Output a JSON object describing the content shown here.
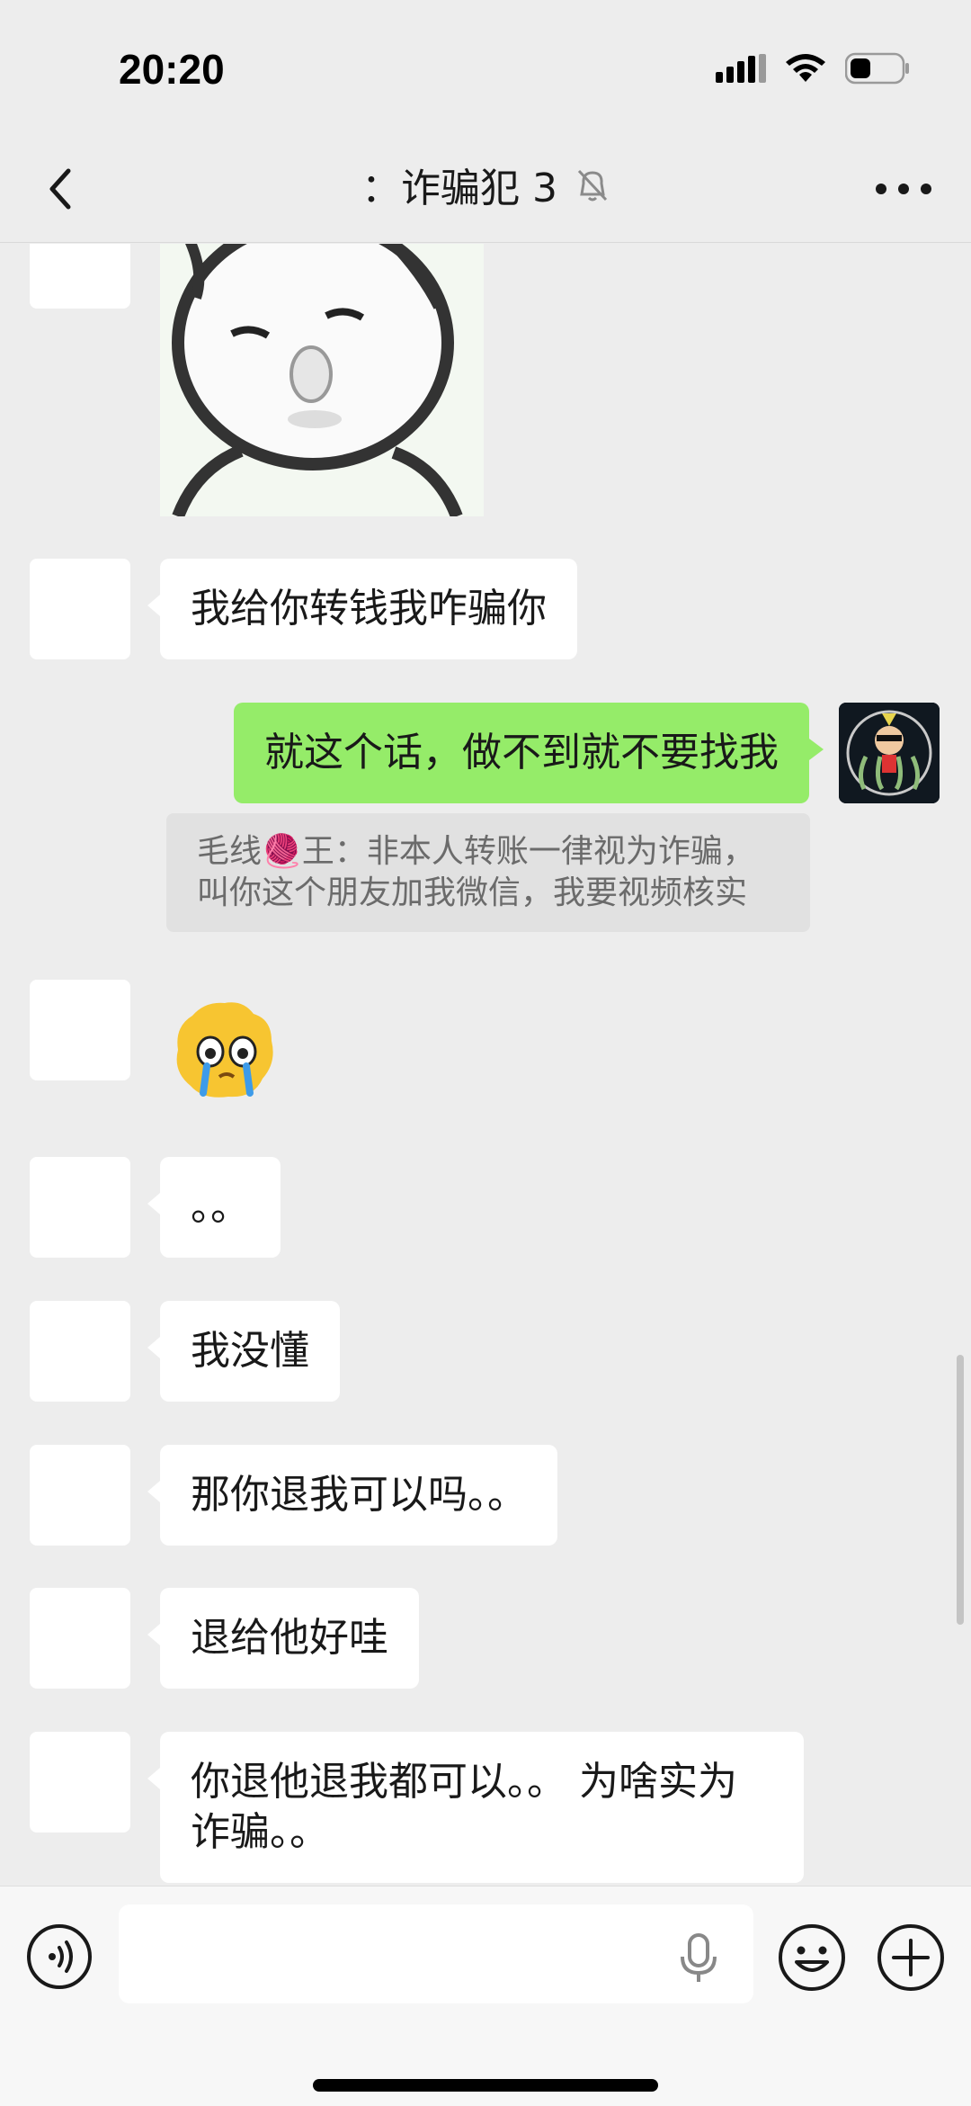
{
  "status_bar": {
    "time": "20:20",
    "icons": [
      "signal-icon",
      "wifi-icon",
      "battery-icon"
    ]
  },
  "nav": {
    "title": "：诈骗犯 3",
    "back_icon": "chevron-left-icon",
    "mute_icon": "bell-slash-icon",
    "more_icon": "more-dots-icon"
  },
  "messages": [
    {
      "side": "other",
      "type": "image",
      "alt": "cartoon face sticker"
    },
    {
      "side": "other",
      "type": "text",
      "text": "我给你转钱我咋骗你"
    },
    {
      "side": "me",
      "type": "text",
      "text": "就这个话，做不到就不要找我"
    },
    {
      "side": "me",
      "type": "quote",
      "line1": "毛线🧶王：非本人转账一律视为诈骗，",
      "line2": "叫你这个朋友加我微信，我要视频核实"
    },
    {
      "side": "other",
      "type": "emoji",
      "emoji": "crying-face-emoji"
    },
    {
      "side": "other",
      "type": "text",
      "text": "。。"
    },
    {
      "side": "other",
      "type": "text",
      "text": "我没懂"
    },
    {
      "side": "other",
      "type": "text",
      "text": "那你退我可以吗。。"
    },
    {
      "side": "other",
      "type": "text",
      "text": "退给他好哇"
    },
    {
      "side": "other",
      "type": "text",
      "line1": "你退他退我都可以。。 为啥实为",
      "line2": "诈骗。。"
    }
  ],
  "input_bar": {
    "placeholder": "",
    "icons": [
      "voice-icon",
      "microphone-icon",
      "emoji-icon",
      "plus-icon"
    ]
  },
  "colors": {
    "background": "#ededed",
    "my_bubble": "#95ec69",
    "other_bubble": "#ffffff",
    "quote_bg": "#e1e1e1"
  }
}
